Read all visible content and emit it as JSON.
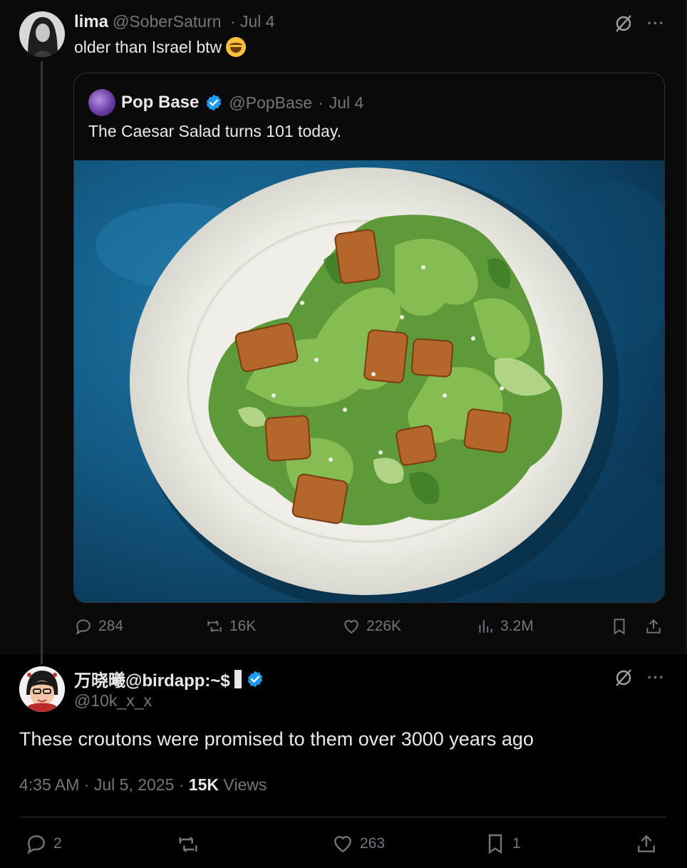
{
  "tweet1": {
    "name": "lima",
    "handle": "@SoberSaturn",
    "date": "Jul 4",
    "text": "older than Israel btw",
    "emoji": "face-with-tears-of-joy"
  },
  "quote": {
    "name": "Pop Base",
    "handle": "@PopBase",
    "date": "Jul 4",
    "text": "The Caesar Salad turns 101 today.",
    "image": "caesar-salad-photo"
  },
  "tweet1_stats": {
    "replies": "284",
    "retweets": "16K",
    "likes": "226K",
    "views": "3.2M"
  },
  "reply": {
    "name": "万晓曦@birdapp:~$",
    "handle": "@10k_x_x",
    "text": "These croutons were promised to them over 3000 years ago",
    "time": "4:35 AM",
    "date": "Jul 5, 2025",
    "views_count": "15K",
    "views_label": "Views",
    "stats": {
      "replies": "2",
      "likes": "263",
      "bookmarks": "1"
    }
  },
  "colors": {
    "background": "#000000",
    "muted": "#71767b",
    "text": "#e7e9ea",
    "verified": "#1d9bf0"
  }
}
